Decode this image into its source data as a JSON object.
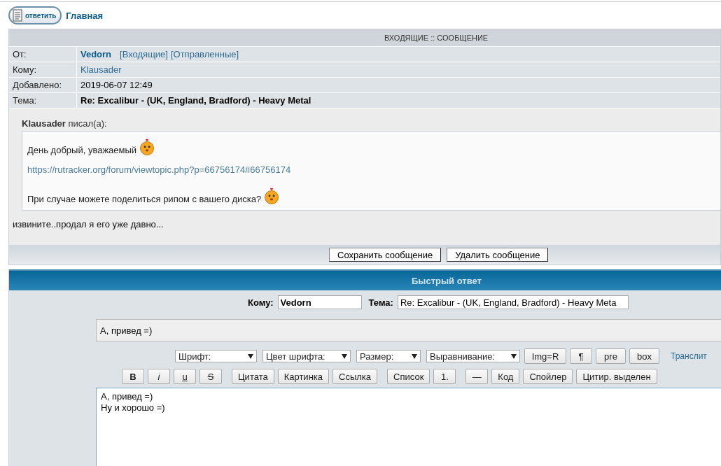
{
  "top_nav": {
    "reply_button": "ответить",
    "home_link": "Главная"
  },
  "message": {
    "title": "ВХОДЯЩИЕ :: СООБЩЕНИЕ",
    "fields": [
      {
        "kind": "sender",
        "label": "От:",
        "value": "Vedorn",
        "links": [
          "[Входящие]",
          "[Отправленные]"
        ]
      },
      {
        "kind": "link",
        "label": "Кому:",
        "value": "Klausader"
      },
      {
        "kind": "plain",
        "label": "Добавлено:",
        "value": "2019-06-07 12:49"
      },
      {
        "kind": "bold",
        "label": "Тема:",
        "value": "Re: Excalibur - (UK, England, Bradford) - Heavy Metal"
      }
    ],
    "quote": {
      "author": "Klausader",
      "wrote": "писал(а):",
      "lines": [
        {
          "kind": "text",
          "text": "День добрый, уважаемый",
          "emoticon": true
        },
        {
          "kind": "link",
          "text": "https://rutracker.org/forum/viewtopic.php?p=66756174#66756174"
        },
        {
          "kind": "text",
          "text": "При случае можете поделиться рипом с вашего диска?",
          "emoticon": true
        }
      ]
    },
    "body": "извините..продал я его уже давно...",
    "buttons": [
      "Сохранить сообщение",
      "Удалить сообщение"
    ]
  },
  "quick_reply": {
    "title": "Быстрый ответ",
    "to_label": "Кому:",
    "to_value": "Vedorn",
    "subject_label": "Тема:",
    "subject_value": "Re: Excalibur - (UK, England, Bradford) - Heavy Meta",
    "preview": "А, привед =)",
    "selects": [
      "Шрифт:",
      "Цвет шрифта:",
      "Размер:",
      "Выравнивание:"
    ],
    "tag_buttons": [
      "Img=R",
      "¶",
      "pre",
      "box"
    ],
    "translit_link": "Транслит",
    "format_groups": [
      [
        {
          "kind": "bold",
          "label": "B"
        },
        {
          "kind": "italic",
          "label": "i"
        },
        {
          "kind": "underline",
          "label": "u"
        },
        {
          "kind": "strike",
          "label": "S"
        }
      ],
      [
        {
          "kind": "plain",
          "label": "Цитата"
        },
        {
          "kind": "plain",
          "label": "Картинка"
        },
        {
          "kind": "plain",
          "label": "Ссылка"
        }
      ],
      [
        {
          "kind": "plain",
          "label": "Список"
        },
        {
          "kind": "plain",
          "label": "1."
        }
      ],
      [
        {
          "kind": "plain",
          "label": "—"
        },
        {
          "kind": "plain",
          "label": "Код"
        },
        {
          "kind": "plain",
          "label": "Спойлер"
        },
        {
          "kind": "plain",
          "label": "Цитир. выделен"
        }
      ]
    ],
    "text": "А, привед =)\nНу и хорошо =)"
  }
}
